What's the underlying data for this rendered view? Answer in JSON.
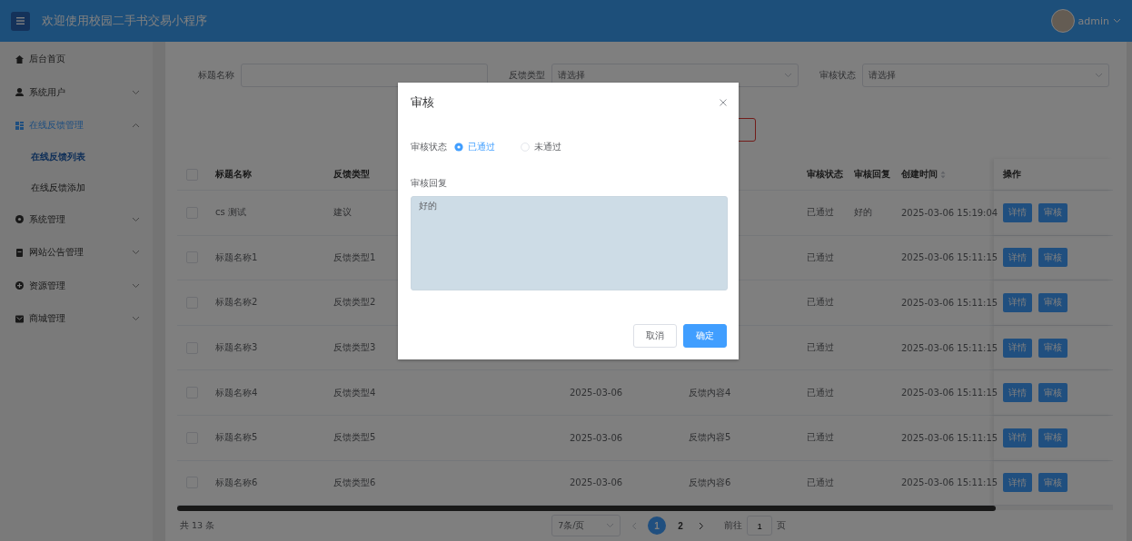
{
  "header": {
    "title": "欢迎使用校园二手书交易小程序",
    "user": "admin"
  },
  "sidebar": {
    "items": [
      {
        "label": "后台首页",
        "kind": "link",
        "selected": false
      },
      {
        "label": "系统用户",
        "kind": "group",
        "expanded": false,
        "selected": false
      },
      {
        "label": "在线反馈管理",
        "kind": "group",
        "expanded": true,
        "selected": true,
        "children": [
          {
            "label": "在线反馈列表",
            "selected": true
          },
          {
            "label": "在线反馈添加",
            "selected": false
          }
        ]
      },
      {
        "label": "系统管理",
        "kind": "group",
        "expanded": false,
        "selected": false
      },
      {
        "label": "网站公告管理",
        "kind": "group",
        "expanded": false,
        "selected": false
      },
      {
        "label": "资源管理",
        "kind": "group",
        "expanded": false,
        "selected": false
      },
      {
        "label": "商城管理",
        "kind": "group",
        "expanded": false,
        "selected": false
      }
    ]
  },
  "filters": [
    {
      "label": "标题名称",
      "kind": "text"
    },
    {
      "label": "反馈类型",
      "kind": "select",
      "placeholder": "请选择"
    },
    {
      "label": "审核状态",
      "kind": "select",
      "placeholder": "请选择"
    }
  ],
  "table": {
    "all_checked": false,
    "columns": [
      {
        "label": "标题名称",
        "sortable": false
      },
      {
        "label": "反馈类型",
        "sortable": false
      },
      null,
      null,
      {
        "label": "审核状态",
        "sortable": false
      },
      {
        "label": "审核回复",
        "sortable": false
      },
      {
        "label": "创建时间",
        "sortable": true
      },
      {
        "label": "操作",
        "sortable": false
      }
    ],
    "rows": [
      {
        "checked": false,
        "cells": [
          "cs 测试",
          "建议",
          null,
          null,
          "已通过",
          "好的",
          "2025-03-06 15:19:04"
        ],
        "actions": [
          "详情",
          "审核"
        ]
      },
      {
        "checked": false,
        "cells": [
          "标题名称1",
          "反馈类型1",
          null,
          null,
          "已通过",
          null,
          "2025-03-06 15:11:15"
        ],
        "actions": [
          "详情",
          "审核"
        ]
      },
      {
        "checked": false,
        "cells": [
          "标题名称2",
          "反馈类型2",
          null,
          null,
          "已通过",
          null,
          "2025-03-06 15:11:15"
        ],
        "actions": [
          "详情",
          "审核"
        ]
      },
      {
        "checked": false,
        "cells": [
          "标题名称3",
          "反馈类型3",
          null,
          null,
          "已通过",
          null,
          "2025-03-06 15:11:15"
        ],
        "actions": [
          "详情",
          "审核"
        ]
      },
      {
        "checked": false,
        "cells": [
          "标题名称4",
          "反馈类型4",
          "2025-03-06",
          "反馈内容4",
          "已通过",
          null,
          "2025-03-06 15:11:15"
        ],
        "actions": [
          "详情",
          "审核"
        ]
      },
      {
        "checked": false,
        "cells": [
          "标题名称5",
          "反馈类型5",
          "2025-03-06",
          "反馈内容5",
          "已通过",
          null,
          "2025-03-06 15:11:15"
        ],
        "actions": [
          "详情",
          "审核"
        ]
      },
      {
        "checked": false,
        "cells": [
          "标题名称6",
          "反馈类型6",
          "2025-03-06",
          "反馈内容6",
          "已通过",
          null,
          "2025-03-06 15:11:15"
        ],
        "actions": [
          "详情",
          "审核"
        ]
      }
    ]
  },
  "pagination": {
    "total": "共 13 条",
    "page_size": "7条/页",
    "pages": [
      {
        "label": "1",
        "selected": true
      },
      {
        "label": "2",
        "selected": false
      }
    ],
    "goto_label": "前往",
    "goto_value": "1",
    "goto_suffix": "页"
  },
  "dialog": {
    "title": "审核",
    "status_label": "审核状态",
    "options": [
      {
        "label": "已通过",
        "selected": true
      },
      {
        "label": "未通过",
        "selected": false
      }
    ],
    "reply_label": "审核回复",
    "reply_value": "好的",
    "buttons": [
      {
        "label": "取消",
        "kind": "default"
      },
      {
        "label": "确定",
        "kind": "primary"
      }
    ]
  }
}
